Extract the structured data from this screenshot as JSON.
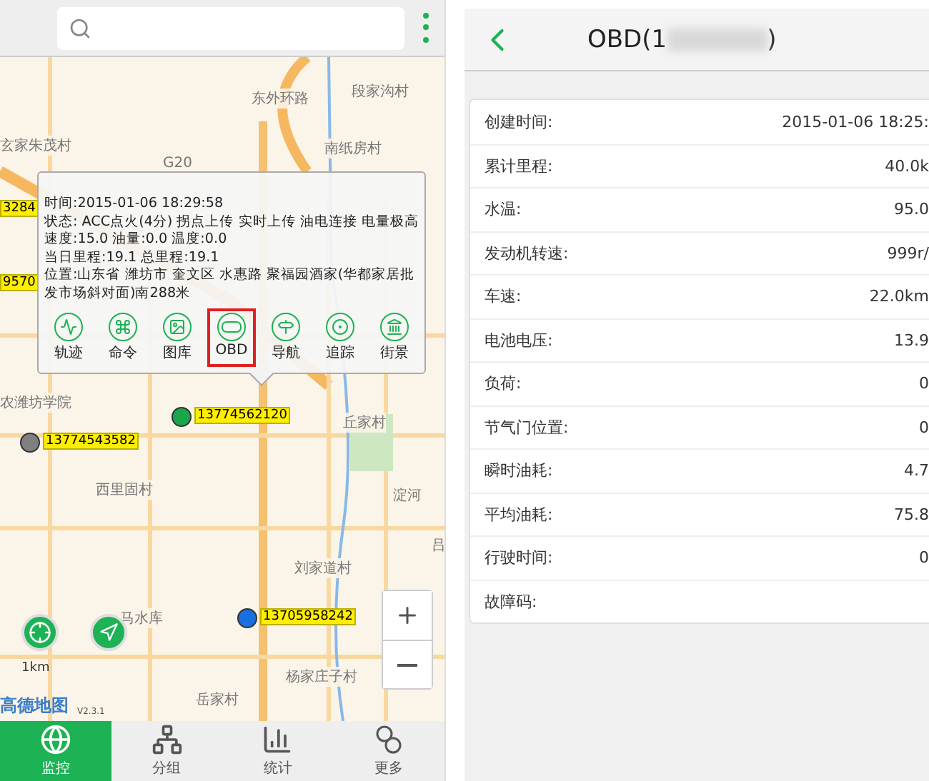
{
  "left_screen": {
    "map": {
      "places": [
        "段家沟村",
        "南纸房村",
        "玄家朱茂村",
        "东外环路",
        "G20",
        "丘家村",
        "淀河",
        "西里固村",
        "刘家道村",
        "杨家庄子村",
        "岳家村",
        "马水库",
        "农潍坊学院",
        "吕"
      ],
      "plates": [
        {
          "text": "3284"
        },
        {
          "text": "9570"
        },
        {
          "text": "13774562120",
          "color": "#1aa64a"
        },
        {
          "text": "13774543582",
          "color": "#808080"
        },
        {
          "text": "13705958242",
          "color": "#1a6fe0"
        }
      ],
      "scale": "1km",
      "logo": "高德地图",
      "version": "V2.3.1"
    },
    "popup": {
      "lines": [
        "时间:2015-01-06 18:29:58",
        "状态: ACC点火(4分) 拐点上传 实时上传  油电连接 电量极高",
        "速度:15.0  油量:0.0  温度:0.0",
        "当日里程:19.1  总里程:19.1",
        "位置:山东省 潍坊市 奎文区 水惠路 聚福园酒家(华都家居批发市场斜对面)南288米"
      ],
      "actions": [
        {
          "kind": "track",
          "label": "轨迹",
          "selected": false
        },
        {
          "kind": "command",
          "label": "命令",
          "selected": false
        },
        {
          "kind": "gallery",
          "label": "图库",
          "selected": false
        },
        {
          "kind": "obd",
          "label": "OBD",
          "selected": true
        },
        {
          "kind": "navigate",
          "label": "导航",
          "selected": false
        },
        {
          "kind": "follow",
          "label": "追踪",
          "selected": false
        },
        {
          "kind": "street",
          "label": "街景",
          "selected": false
        }
      ]
    },
    "nav": [
      {
        "kind": "monitor",
        "label": "监控",
        "selected": true
      },
      {
        "kind": "group",
        "label": "分组",
        "selected": false
      },
      {
        "kind": "stats",
        "label": "统计",
        "selected": false
      },
      {
        "kind": "more",
        "label": "更多",
        "selected": false
      }
    ]
  },
  "right_screen": {
    "title": "OBD(1",
    "title_end": ")",
    "rows": [
      {
        "label": "创建时间:",
        "value": "2015-01-06 18:25:"
      },
      {
        "label": "累计里程:",
        "value": "40.0k"
      },
      {
        "label": "水温:",
        "value": "95.0"
      },
      {
        "label": "发动机转速:",
        "value": "999r/"
      },
      {
        "label": "车速:",
        "value": "22.0km"
      },
      {
        "label": "电池电压:",
        "value": "13.9"
      },
      {
        "label": "负荷:",
        "value": "0"
      },
      {
        "label": "节气门位置:",
        "value": "0"
      },
      {
        "label": "瞬时油耗:",
        "value": "4.7"
      },
      {
        "label": "平均油耗:",
        "value": "75.8"
      },
      {
        "label": "行驶时间:",
        "value": "0"
      },
      {
        "label": "故障码:",
        "value": ""
      }
    ]
  }
}
